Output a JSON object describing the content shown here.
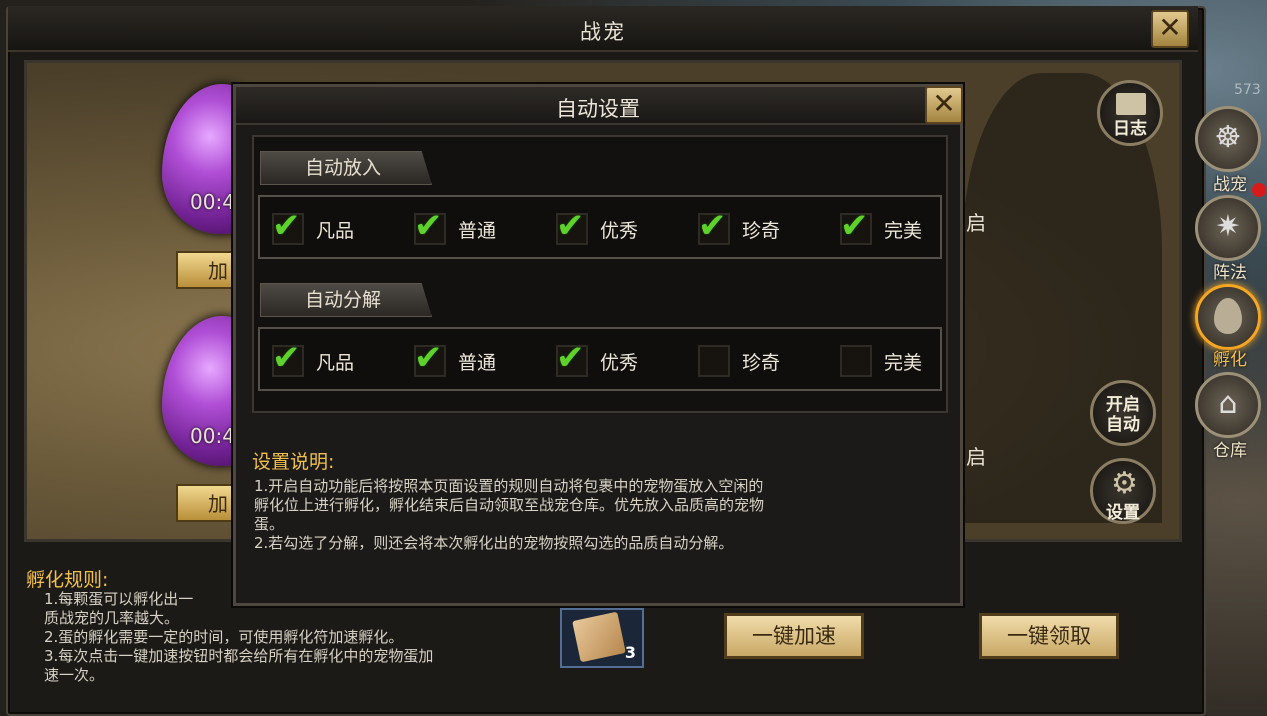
{
  "main_window": {
    "title": "战宠",
    "close_glyph": "✕"
  },
  "scene": {
    "egg_top_time": "00:4",
    "egg_bottom_time": "00:4",
    "egg_top_btn": "加",
    "egg_bottom_btn": "加",
    "kai_top": "启",
    "kai_bottom": "启",
    "log_button": "日志",
    "auto_start_button_line1": "开启",
    "auto_start_button_line2": "自动",
    "settings_button": "设置"
  },
  "side_tabs": [
    {
      "label": "战宠",
      "icon": "lion-head-icon",
      "active": false,
      "has_notification": true
    },
    {
      "label": "阵法",
      "icon": "star-compass-icon",
      "active": false,
      "has_notification": false
    },
    {
      "label": "孵化",
      "icon": "egg-icon",
      "active": true,
      "has_notification": false
    },
    {
      "label": "仓库",
      "icon": "house-icon",
      "active": false,
      "has_notification": false
    }
  ],
  "corner_number": "573",
  "rules": {
    "title": "孵化规则:",
    "lines": [
      "1.每颗蛋可以孵化出一",
      "质战宠的几率越大。",
      "2.蛋的孵化需要一定的时间，可使用孵化符加速孵化。",
      "3.每次点击一键加速按钮时都会给所有在孵化中的宠物蛋加",
      "速一次。"
    ]
  },
  "item_ticket": {
    "count": "3",
    "icon": "hatch-talisman-icon"
  },
  "buttons": {
    "speed_all": "一键加速",
    "claim_all": "一键领取"
  },
  "dialog": {
    "title": "自动设置",
    "close_glyph": "✕",
    "auto_put": {
      "tab_label": "自动放入",
      "options": [
        {
          "label": "凡品",
          "checked": true
        },
        {
          "label": "普通",
          "checked": true
        },
        {
          "label": "优秀",
          "checked": true
        },
        {
          "label": "珍奇",
          "checked": true
        },
        {
          "label": "完美",
          "checked": true
        }
      ]
    },
    "auto_decompose": {
      "tab_label": "自动分解",
      "options": [
        {
          "label": "凡品",
          "checked": true
        },
        {
          "label": "普通",
          "checked": true
        },
        {
          "label": "优秀",
          "checked": true
        },
        {
          "label": "珍奇",
          "checked": false
        },
        {
          "label": "完美",
          "checked": false
        }
      ]
    },
    "desc_title": "设置说明:",
    "desc_lines": [
      "1.开启自动功能后将按照本页面设置的规则自动将包裹中的宠物蛋放入空闲的",
      "孵化位上进行孵化，孵化结束后自动领取至战宠仓库。优先放入品质高的宠物",
      "蛋。",
      "2.若勾选了分解，则还会将本次孵化出的宠物按照勾选的品质自动分解。"
    ],
    "check_glyph": "✔"
  },
  "colors": {
    "gold_text": "#f2c14a",
    "check_green": "#5ed12a",
    "button_gold": "#c9a866",
    "active_tab_glow": "#f5a623",
    "notification_red": "#d81a1a"
  }
}
